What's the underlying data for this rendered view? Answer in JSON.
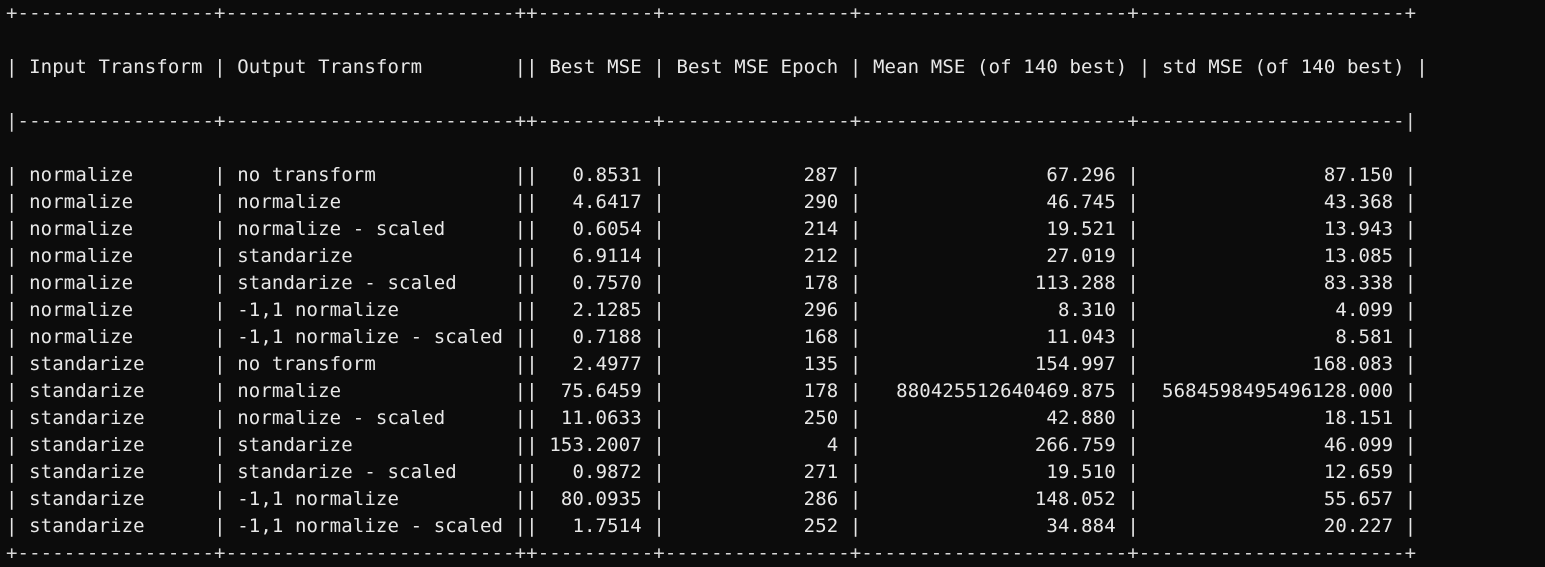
{
  "table": {
    "headers": [
      "Input Transform",
      "Output Transform",
      "Best MSE",
      "Best MSE Epoch",
      "Mean MSE (of 140 best)",
      "std MSE (of 140 best)"
    ],
    "rows": [
      [
        "normalize",
        "no transform",
        "0.8531",
        "287",
        "67.296",
        "87.150"
      ],
      [
        "normalize",
        "normalize",
        "4.6417",
        "290",
        "46.745",
        "43.368"
      ],
      [
        "normalize",
        "normalize - scaled",
        "0.6054",
        "214",
        "19.521",
        "13.943"
      ],
      [
        "normalize",
        "standarize",
        "6.9114",
        "212",
        "27.019",
        "13.085"
      ],
      [
        "normalize",
        "standarize - scaled",
        "0.7570",
        "178",
        "113.288",
        "83.338"
      ],
      [
        "normalize",
        "-1,1 normalize",
        "2.1285",
        "296",
        "8.310",
        "4.099"
      ],
      [
        "normalize",
        "-1,1 normalize - scaled",
        "0.7188",
        "168",
        "11.043",
        "8.581"
      ],
      [
        "standarize",
        "no transform",
        "2.4977",
        "135",
        "154.997",
        "168.083"
      ],
      [
        "standarize",
        "normalize",
        "75.6459",
        "178",
        "880425512640469.875",
        "5684598495496128.000"
      ],
      [
        "standarize",
        "normalize - scaled",
        "11.0633",
        "250",
        "42.880",
        "18.151"
      ],
      [
        "standarize",
        "standarize",
        "153.2007",
        "4",
        "266.759",
        "46.099"
      ],
      [
        "standarize",
        "standarize - scaled",
        "0.9872",
        "271",
        "19.510",
        "12.659"
      ],
      [
        "standarize",
        "-1,1 normalize",
        "80.0935",
        "286",
        "148.052",
        "55.657"
      ],
      [
        "standarize",
        "-1,1 normalize - scaled",
        "1.7514",
        "252",
        "34.884",
        "20.227"
      ]
    ]
  }
}
